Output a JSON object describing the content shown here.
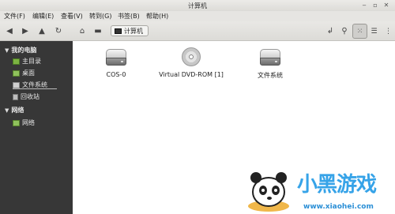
{
  "window": {
    "title": "计算机"
  },
  "menu": [
    "文件(F)",
    "编辑(E)",
    "查看(V)",
    "转到(G)",
    "书签(B)",
    "帮助(H)"
  ],
  "toolbar": {
    "breadcrumb": "计算机",
    "icons": [
      "back-arrow",
      "forward-arrow",
      "up-arrow",
      "reload",
      "home",
      "computer",
      "toggle-location",
      "search",
      "icon-view",
      "list-view",
      "compact-view"
    ]
  },
  "sidebar": {
    "sections": [
      {
        "label": "我的电脑",
        "items": [
          "主目录",
          "桌面",
          "文件系统",
          "回收站"
        ]
      },
      {
        "label": "网络",
        "items": [
          "网络"
        ]
      }
    ]
  },
  "content": {
    "items": [
      {
        "label": "COS-0",
        "icon": "hard-drive"
      },
      {
        "label": "Virtual DVD-ROM [1]",
        "icon": "optical-disc"
      },
      {
        "label": "文件系统",
        "icon": "hard-drive"
      }
    ]
  },
  "watermark": {
    "brand": "小黑游戏",
    "site": "www.xiaohei.com"
  }
}
